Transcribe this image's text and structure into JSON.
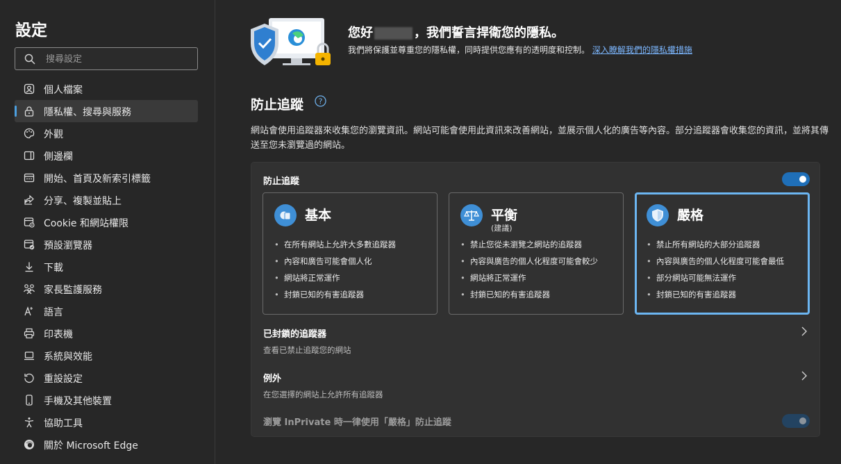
{
  "sidebar": {
    "title": "設定",
    "search_placeholder": "搜尋設定",
    "items": [
      {
        "label": "個人檔案",
        "icon": "profile-icon"
      },
      {
        "label": "隱私權、搜尋與服務",
        "icon": "lock-icon",
        "active": true
      },
      {
        "label": "外觀",
        "icon": "palette-icon"
      },
      {
        "label": "側邊欄",
        "icon": "sidebar-panel-icon"
      },
      {
        "label": "開始、首頁及新索引標籤",
        "icon": "home-tabs-icon"
      },
      {
        "label": "分享、複製並貼上",
        "icon": "share-icon"
      },
      {
        "label": "Cookie 和網站權限",
        "icon": "site-permissions-icon"
      },
      {
        "label": "預設瀏覽器",
        "icon": "default-browser-icon"
      },
      {
        "label": "下載",
        "icon": "download-icon"
      },
      {
        "label": "家長監護服務",
        "icon": "family-icon"
      },
      {
        "label": "語言",
        "icon": "language-icon"
      },
      {
        "label": "印表機",
        "icon": "printer-icon"
      },
      {
        "label": "系統與效能",
        "icon": "laptop-icon"
      },
      {
        "label": "重設設定",
        "icon": "reset-icon"
      },
      {
        "label": "手機及其他裝置",
        "icon": "phone-icon"
      },
      {
        "label": "協助工具",
        "icon": "accessibility-icon"
      },
      {
        "label": "關於 Microsoft Edge",
        "icon": "edge-logo-icon"
      }
    ]
  },
  "hero": {
    "heading_prefix": "您好",
    "heading_suffix": "，我們誓言捍衛您的隱私。",
    "description": "我們將保護並尊重您的隱私權，同時提供您應有的透明度和控制。",
    "link_text": "深入瞭解我們的隱私權措施"
  },
  "tracking": {
    "section_title": "防止追蹤",
    "section_description": "網站會使用追蹤器來收集您的瀏覽資訊。網站可能會使用此資訊來改善網站，並展示個人化的廣告等內容。部分追蹤器會收集您的資訊，並將其傳送至您未瀏覽過的網站。",
    "card_label": "防止追蹤",
    "toggle_on": true,
    "levels": [
      {
        "title": "基本",
        "subtitle": "",
        "icon": "basic-level-icon",
        "selected": false,
        "bullets": [
          "在所有網站上允許大多數追蹤器",
          "內容和廣告可能會個人化",
          "網站將正常運作",
          "封鎖已知的有害追蹤器"
        ]
      },
      {
        "title": "平衡",
        "subtitle": "(建議)",
        "icon": "balance-scale-icon",
        "selected": false,
        "bullets": [
          "禁止您從未瀏覽之網站的追蹤器",
          "內容與廣告的個人化程度可能會較少",
          "網站將正常運作",
          "封鎖已知的有害追蹤器"
        ]
      },
      {
        "title": "嚴格",
        "subtitle": "",
        "icon": "shield-icon",
        "selected": true,
        "bullets": [
          "禁止所有網站的大部分追蹤器",
          "內容與廣告的個人化程度可能會最低",
          "部分網站可能無法運作",
          "封鎖已知的有害追蹤器"
        ]
      }
    ],
    "blocked_title": "已封鎖的追蹤器",
    "blocked_subtitle": "查看已禁止追蹤您的網站",
    "exceptions_title": "例外",
    "exceptions_subtitle": "在您選擇的網站上允許所有追蹤器",
    "inprivate_label": "瀏覽 InPrivate 時一律使用「嚴格」防止追蹤",
    "inprivate_toggle_on": true
  },
  "colors": {
    "accent": "#4ca0e0",
    "link": "#7cb7ff",
    "toggle_on": "#1f6fb8",
    "background": "#272727",
    "card": "#313131"
  }
}
